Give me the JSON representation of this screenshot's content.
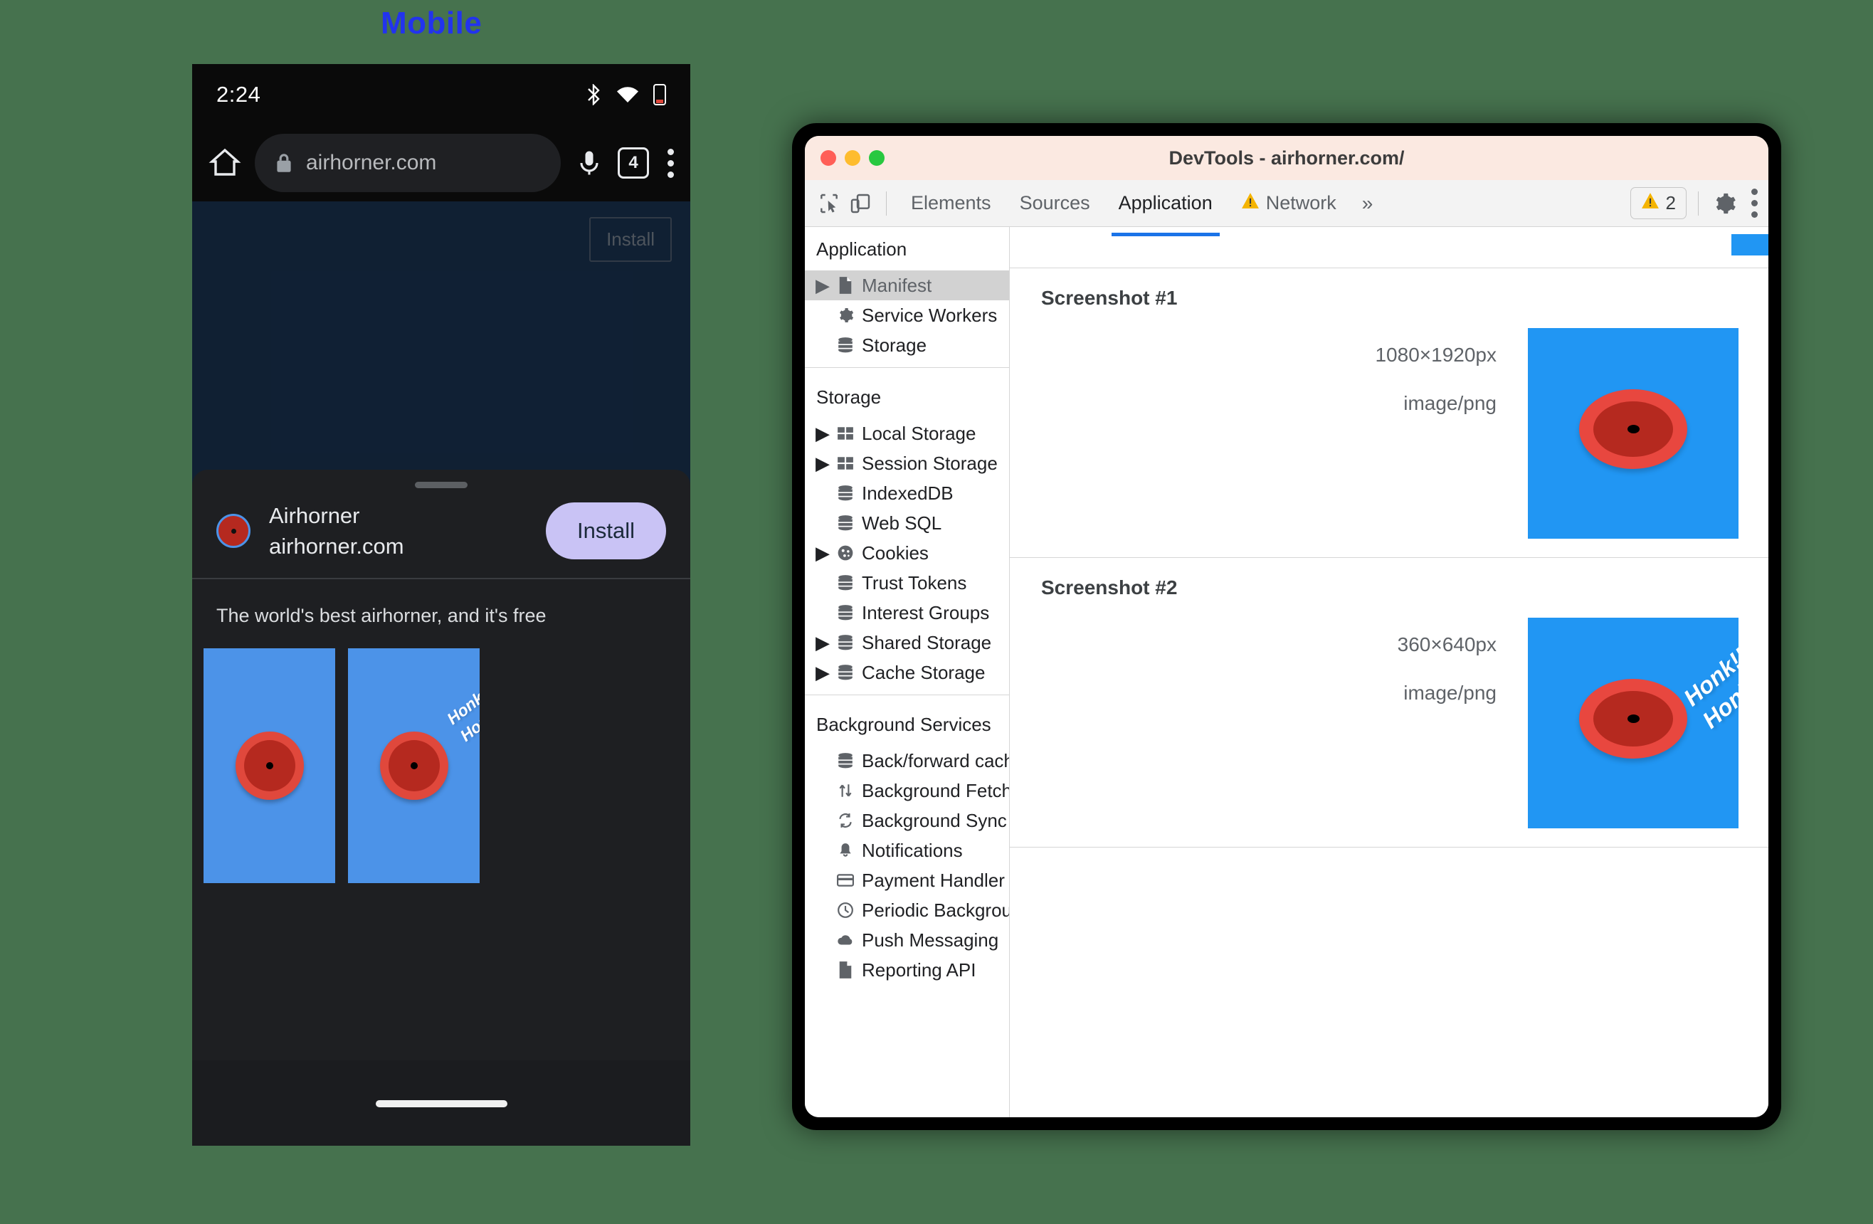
{
  "page": {
    "label": "Mobile",
    "label_color": "#2233ee",
    "background_color": "#46724e"
  },
  "phone": {
    "status": {
      "time": "2:24",
      "icons": [
        "bluetooth-icon",
        "wifi-icon",
        "battery-icon"
      ]
    },
    "browser": {
      "home_icon": "home-icon",
      "lock_icon": "lock-icon",
      "url": "airhorner.com",
      "mic_icon": "microphone-icon",
      "tab_count": "4",
      "menu_icon": "kebab-menu-icon"
    },
    "viewport": {
      "install_button": "Install",
      "background_color": "#1e3b5e"
    },
    "install_sheet": {
      "app_name": "Airhorner",
      "app_host": "airhorner.com",
      "install_label": "Install",
      "install_color": "#c9c3f5",
      "description": "The world's best airhorner, and it's free",
      "screenshots": [
        {
          "honk": ""
        },
        {
          "honk": "Honk!!\nHonk!!"
        }
      ]
    }
  },
  "devtools": {
    "window_title": "DevTools - airhorner.com/",
    "traffic_lights": [
      "#ff5f57",
      "#febc2e",
      "#28c840"
    ],
    "toolbar_icons": [
      "inspect-element-icon",
      "device-toolbar-icon"
    ],
    "tabs": [
      {
        "label": "Elements",
        "active": false,
        "warning": false
      },
      {
        "label": "Sources",
        "active": false,
        "warning": false
      },
      {
        "label": "Application",
        "active": true,
        "warning": false
      },
      {
        "label": "Network",
        "active": false,
        "warning": true
      }
    ],
    "overflow_icon": "chevron-double-right-icon",
    "warning_badge": {
      "icon": "warning-triangle-icon",
      "count": "2"
    },
    "settings_icon": "gear-icon",
    "more_icon": "kebab-menu-icon",
    "accent_color": "#1a73e8",
    "sidebar": {
      "sections": [
        {
          "title": "Application",
          "items": [
            {
              "label": "Manifest",
              "icon": "document-icon",
              "expandable": true,
              "selected": true
            },
            {
              "label": "Service Workers",
              "icon": "gear-icon",
              "expandable": false,
              "selected": false
            },
            {
              "label": "Storage",
              "icon": "database-icon",
              "expandable": false,
              "selected": false
            }
          ]
        },
        {
          "title": "Storage",
          "items": [
            {
              "label": "Local Storage",
              "icon": "table-icon",
              "expandable": true,
              "selected": false
            },
            {
              "label": "Session Storage",
              "icon": "table-icon",
              "expandable": true,
              "selected": false
            },
            {
              "label": "IndexedDB",
              "icon": "database-icon",
              "expandable": false,
              "selected": false
            },
            {
              "label": "Web SQL",
              "icon": "database-icon",
              "expandable": false,
              "selected": false
            },
            {
              "label": "Cookies",
              "icon": "cookie-icon",
              "expandable": true,
              "selected": false
            },
            {
              "label": "Trust Tokens",
              "icon": "database-icon",
              "expandable": false,
              "selected": false
            },
            {
              "label": "Interest Groups",
              "icon": "database-icon",
              "expandable": false,
              "selected": false
            },
            {
              "label": "Shared Storage",
              "icon": "database-icon",
              "expandable": true,
              "selected": false
            },
            {
              "label": "Cache Storage",
              "icon": "database-icon",
              "expandable": true,
              "selected": false
            }
          ]
        },
        {
          "title": "Background Services",
          "items": [
            {
              "label": "Back/forward cache",
              "icon": "database-icon",
              "expandable": false,
              "selected": false
            },
            {
              "label": "Background Fetch",
              "icon": "up-down-arrows-icon",
              "expandable": false,
              "selected": false
            },
            {
              "label": "Background Sync",
              "icon": "sync-icon",
              "expandable": false,
              "selected": false
            },
            {
              "label": "Notifications",
              "icon": "bell-icon",
              "expandable": false,
              "selected": false
            },
            {
              "label": "Payment Handler",
              "icon": "credit-card-icon",
              "expandable": false,
              "selected": false
            },
            {
              "label": "Periodic Background Sync",
              "icon": "clock-icon",
              "expandable": false,
              "selected": false
            },
            {
              "label": "Push Messaging",
              "icon": "cloud-icon",
              "expandable": false,
              "selected": false
            },
            {
              "label": "Reporting API",
              "icon": "document-icon",
              "expandable": false,
              "selected": false
            }
          ]
        }
      ]
    },
    "manifest_panel": {
      "screenshots": [
        {
          "title": "Screenshot #1",
          "size": "1080×1920px",
          "mime": "image/png",
          "honk": ""
        },
        {
          "title": "Screenshot #2",
          "size": "360×640px",
          "mime": "image/png",
          "honk": "Honk!!\nHonk!!"
        }
      ]
    }
  }
}
